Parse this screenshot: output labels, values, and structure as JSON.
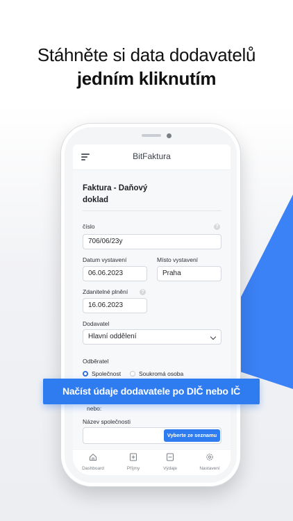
{
  "headline": {
    "line1": "Stáhněte si data dodavatelů",
    "line2": "jedním kliknutím"
  },
  "app": {
    "title": "BitFaktura",
    "card_title": "Faktura - Daňový doklad",
    "fields": {
      "number_label": "číslo",
      "number_value": "706/06/23y",
      "issue_date_label": "Datum vystavení",
      "issue_date_value": "06.06.2023",
      "issue_place_label": "Místo vystavení",
      "issue_place_value": "Praha",
      "taxable_label": "Zdanitelné plnění",
      "taxable_value": "16.06.2023",
      "supplier_label": "Dodavatel",
      "supplier_value": "Hlavní oddělení",
      "customer_label": "Odběratel",
      "radio_company": "Společnost",
      "radio_private": "Soukromá osoba",
      "or_label": "nebo:",
      "company_name_label": "Název společnosti",
      "pick_button": "Vyberte ze seznamu"
    },
    "help_glyph": "?",
    "tabs": [
      "Dashboard",
      "Příjmy",
      "Výdaje",
      "Nastavení"
    ]
  },
  "banner": "Načíst údaje dodavatele po DIČ nebo IČ",
  "colors": {
    "accent": "#2f7bf0",
    "triangle": "#3b82f6"
  },
  "icons": [
    "menu-icon",
    "home-icon",
    "income-icon",
    "expense-icon",
    "settings-icon",
    "chevron-down-icon",
    "help-icon"
  ]
}
